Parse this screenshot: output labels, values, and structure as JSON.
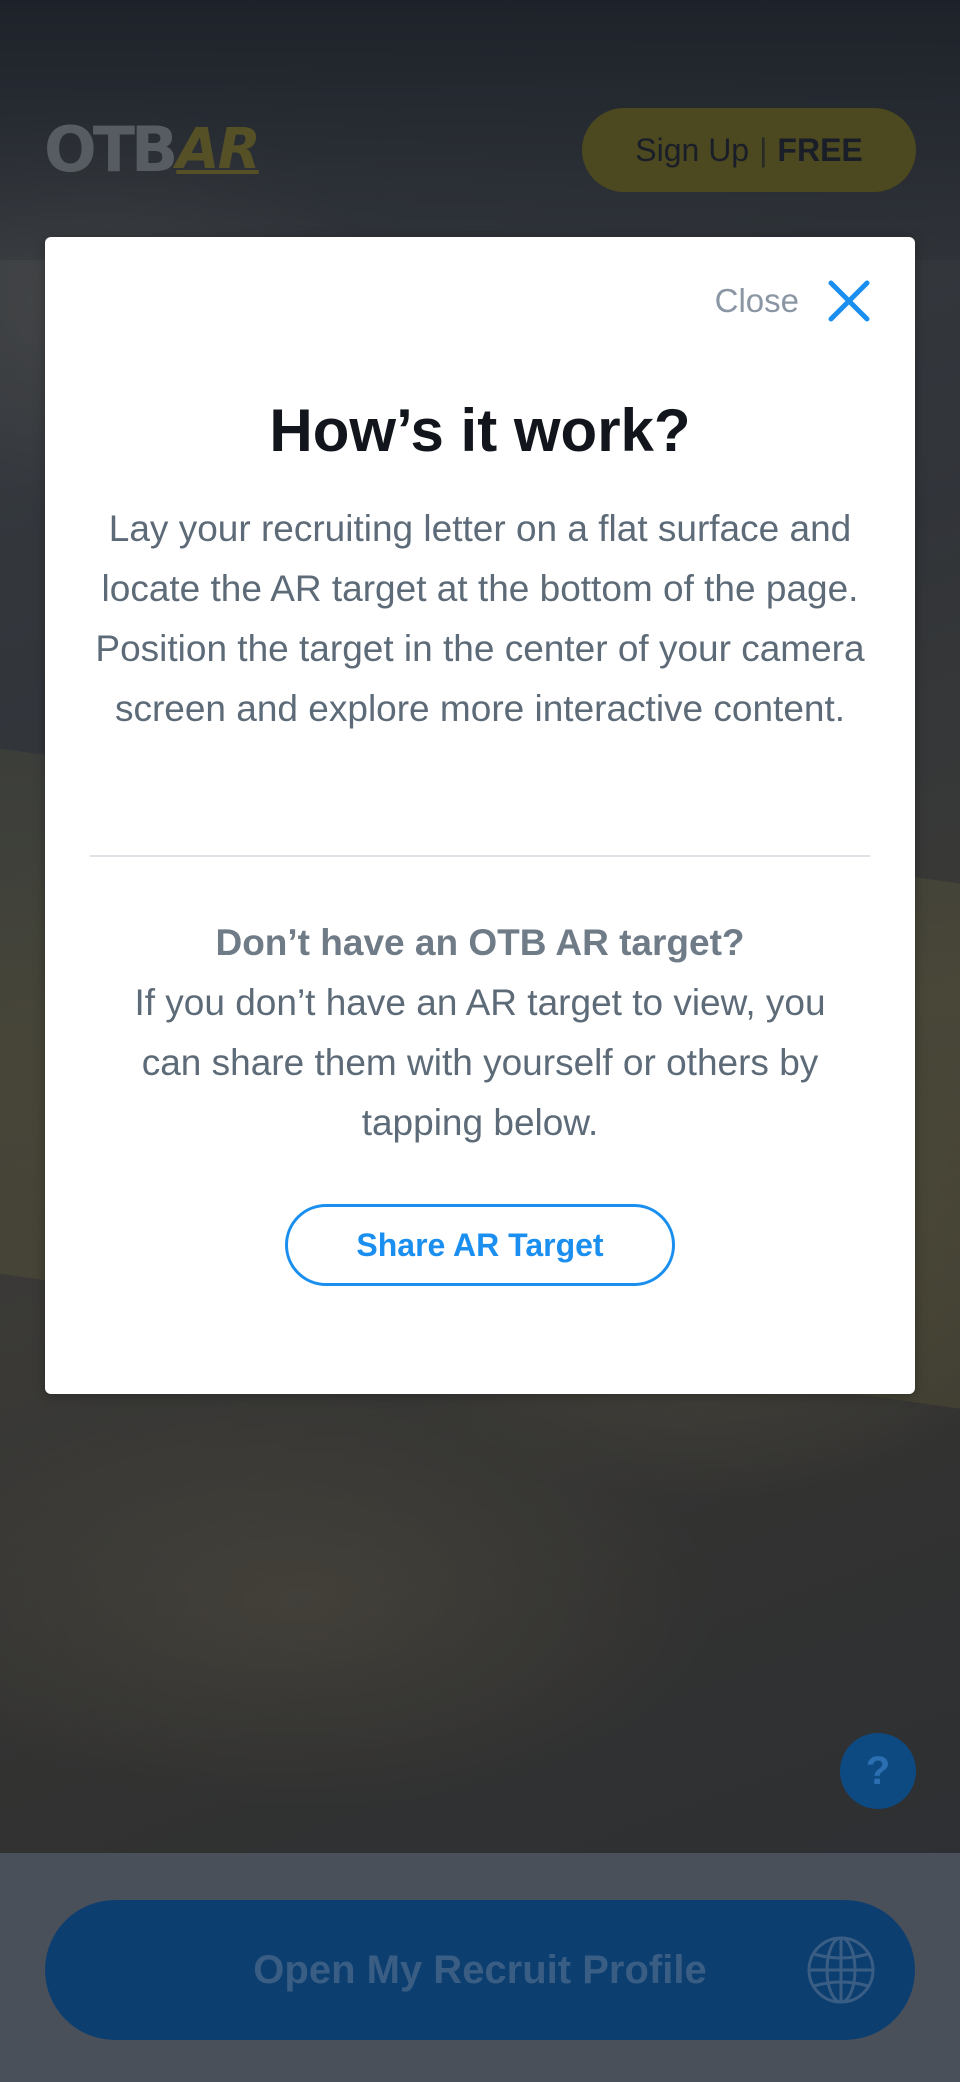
{
  "header": {
    "logo_primary": "OTB",
    "logo_secondary": "AR",
    "signup_label": "Sign Up",
    "signup_separator": "|",
    "signup_emphasis": "FREE"
  },
  "modal": {
    "close_label": "Close",
    "title": "How’s it work?",
    "body": "Lay your recruiting letter on a flat surface and locate the AR target at the bottom of the page. Position the target in the center of your camera screen and explore more interactive content.",
    "subhead": "Don’t have an OTB AR target?",
    "subbody": "If you don’t have an AR target to view, you can share them with yourself or others by tapping below.",
    "share_button": "Share AR Target"
  },
  "help": {
    "label": "?"
  },
  "bottom": {
    "profile_button": "Open My Recruit Profile",
    "profile_icon": "globe-icon"
  },
  "colors": {
    "accent_blue": "#1b8ff0",
    "signup_yellow": "#7a6f1f",
    "title_dark": "#12161c",
    "body_gray": "#5d6b78"
  }
}
